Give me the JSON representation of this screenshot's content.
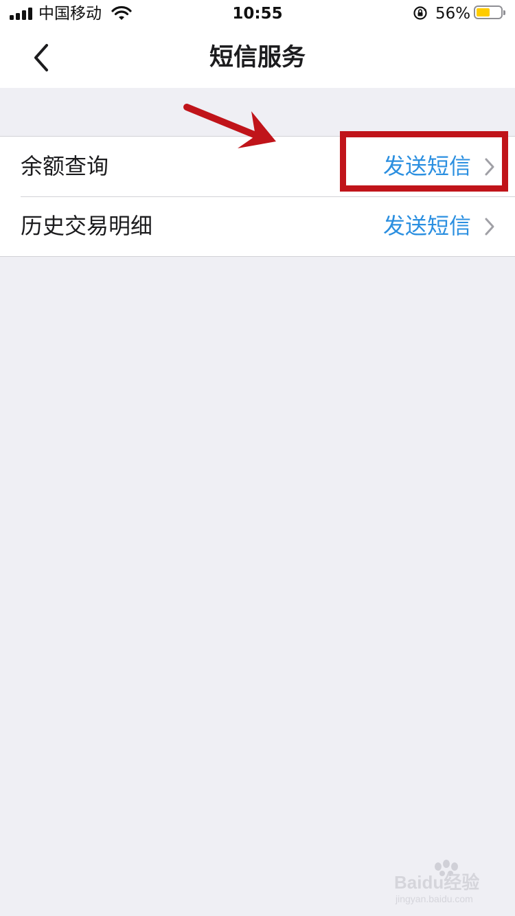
{
  "status_bar": {
    "carrier": "中国移动",
    "time": "10:55",
    "battery_percent": "56%",
    "battery_level": 0.56,
    "battery_color": "#ffcc00"
  },
  "nav": {
    "title": "短信服务",
    "back_icon": "chevron-left-icon"
  },
  "list": {
    "items": [
      {
        "label": "余额查询",
        "action": "发送短信",
        "icon": "chevron-right-icon"
      },
      {
        "label": "历史交易明细",
        "action": "发送短信",
        "icon": "chevron-right-icon"
      }
    ]
  },
  "annotation": {
    "color": "#c0141a"
  },
  "watermark": {
    "brand": "Baidu经验",
    "url": "jingyan.baidu.com"
  },
  "colors": {
    "accent": "#2b8fe0",
    "background": "#efeff4"
  }
}
